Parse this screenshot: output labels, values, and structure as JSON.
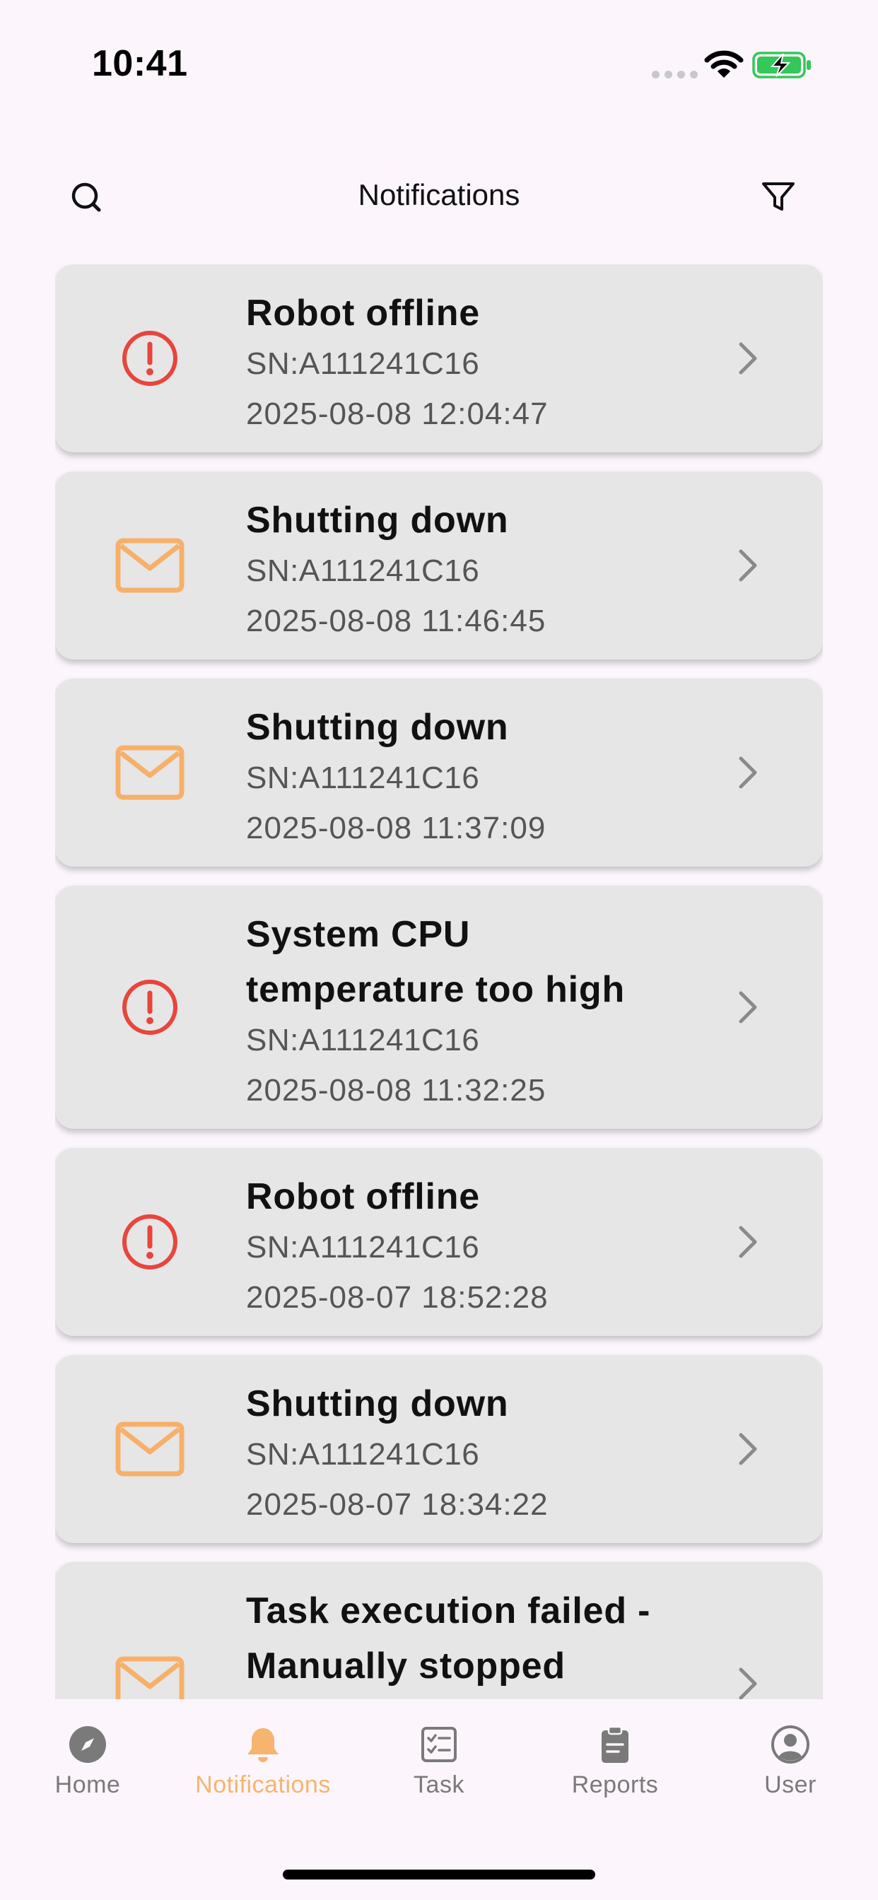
{
  "status_bar": {
    "time": "10:41"
  },
  "header": {
    "title": "Notifications",
    "search_icon": "search-icon",
    "filter_icon": "filter-icon"
  },
  "colors": {
    "alert": "#e8453c",
    "message": "#f7b06a",
    "accent": "#f6b46e",
    "card": "#e6e6e6",
    "background": "#fcf6fc"
  },
  "notifications": [
    {
      "type": "alert",
      "icon": "alert-circle-icon",
      "title": "Robot offline",
      "sn": "SN:A111241C16",
      "time": "2025-08-08 12:04:47"
    },
    {
      "type": "message",
      "icon": "mail-icon",
      "title": "Shutting down",
      "sn": "SN:A111241C16",
      "time": "2025-08-08 11:46:45"
    },
    {
      "type": "message",
      "icon": "mail-icon",
      "title": "Shutting down",
      "sn": "SN:A111241C16",
      "time": "2025-08-08 11:37:09"
    },
    {
      "type": "alert",
      "icon": "alert-circle-icon",
      "title_line1": "System CPU",
      "title_line2": "temperature too high",
      "sn": "SN:A111241C16",
      "time": "2025-08-08 11:32:25"
    },
    {
      "type": "alert",
      "icon": "alert-circle-icon",
      "title": "Robot offline",
      "sn": "SN:A111241C16",
      "time": "2025-08-07 18:52:28"
    },
    {
      "type": "message",
      "icon": "mail-icon",
      "title": "Shutting down",
      "sn": "SN:A111241C16",
      "time": "2025-08-07 18:34:22"
    },
    {
      "type": "message",
      "icon": "mail-icon",
      "title_line1": "Task execution failed -",
      "title_line2": "Manually stopped"
    }
  ],
  "tabs": [
    {
      "label": "Home",
      "icon": "compass-icon"
    },
    {
      "label": "Notifications",
      "icon": "bell-icon",
      "active": true
    },
    {
      "label": "Task",
      "icon": "task-list-icon"
    },
    {
      "label": "Reports",
      "icon": "clipboard-icon"
    },
    {
      "label": "User",
      "icon": "user-circle-icon"
    }
  ]
}
